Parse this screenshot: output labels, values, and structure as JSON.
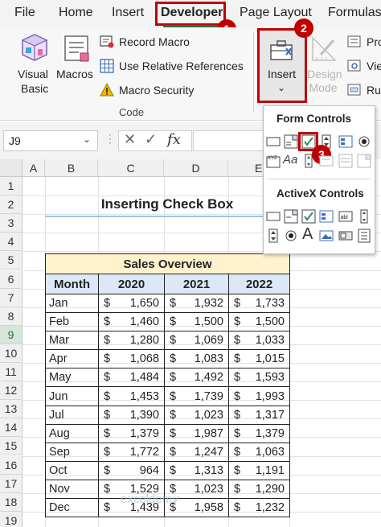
{
  "menu": {
    "tabs": [
      "File",
      "Home",
      "Insert",
      "Developer",
      "Page Layout",
      "Formulas"
    ]
  },
  "ribbon": {
    "visual_basic": "Visual\nBasic",
    "visual_basic_1": "Visual",
    "visual_basic_2": "Basic",
    "macros": "Macros",
    "record_macro": "Record Macro",
    "use_relative": "Use Relative References",
    "macro_security": "Macro Security",
    "group_code": "Code",
    "insert": "Insert",
    "design_1": "Design",
    "design_2": "Mode",
    "pro": "Pro",
    "vie": "Vie",
    "ru": "Ru"
  },
  "badges": [
    "1",
    "2",
    "3"
  ],
  "formula_bar": {
    "name_box": "J9",
    "fx": "fx"
  },
  "columns": [
    "A",
    "B",
    "C",
    "D",
    "E"
  ],
  "rows": [
    "1",
    "2",
    "3",
    "4",
    "5",
    "6",
    "7",
    "8",
    "9",
    "10",
    "11",
    "12",
    "13",
    "14",
    "15",
    "16",
    "17",
    "18",
    "19"
  ],
  "sheet": {
    "title": "Inserting Check Box",
    "table_title": "Sales Overview",
    "headers": [
      "Month",
      "2020",
      "2021",
      "2022"
    ],
    "currency": "$",
    "data": [
      [
        "Jan",
        "1,650",
        "1,932",
        "1,733"
      ],
      [
        "Feb",
        "1,460",
        "1,500",
        "1,500"
      ],
      [
        "Mar",
        "1,280",
        "1,069",
        "1,033"
      ],
      [
        "Apr",
        "1,068",
        "1,083",
        "1,015"
      ],
      [
        "May",
        "1,484",
        "1,492",
        "1,593"
      ],
      [
        "Jun",
        "1,453",
        "1,739",
        "1,993"
      ],
      [
        "Jul",
        "1,390",
        "1,023",
        "1,317"
      ],
      [
        "Aug",
        "1,379",
        "1,987",
        "1,379"
      ],
      [
        "Sep",
        "1,772",
        "1,247",
        "1,063"
      ],
      [
        "Oct",
        "964",
        "1,313",
        "1,191"
      ],
      [
        "Nov",
        "1,529",
        "1,023",
        "1,290"
      ],
      [
        "Dec",
        "1,439",
        "1,958",
        "1,232"
      ]
    ],
    "watermark": "exceldemy"
  },
  "dropdown": {
    "form_controls": "Form Controls",
    "activex_controls": "ActiveX Controls"
  },
  "colors": {
    "highlight_red": "#c00000",
    "excel_green": "#217346",
    "table_title_fill": "#fff2cc",
    "table_header_fill": "#dde8f7"
  }
}
